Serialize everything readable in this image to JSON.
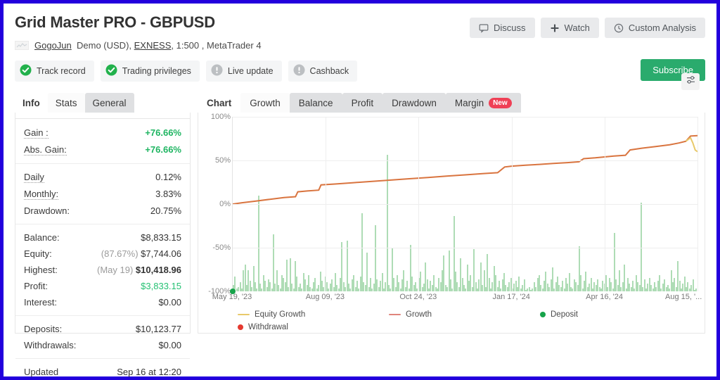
{
  "theme": {
    "page_border": "#2200dd",
    "accent_green": "#2aab6d",
    "value_green": "#1fb562",
    "badge_red": "#ef4056",
    "growth_line": "#d9743f",
    "equity_line": "#e8c96a",
    "bar_green": "#aedcb5"
  },
  "header": {
    "title": "Grid Master PRO - GBPUSD",
    "account_name": "GogoJun",
    "account_type": "Demo (USD),",
    "broker": "EXNESS",
    "leverage": ", 1:500 ,",
    "platform": "MetaTrader 4",
    "logo_icon": "broker-logo-icon",
    "buttons": [
      {
        "label": "Discuss",
        "icon": "speech-bubble-icon"
      },
      {
        "label": "Watch",
        "icon": "plus-icon"
      },
      {
        "label": "Custom Analysis",
        "icon": "clock-icon"
      }
    ]
  },
  "badges": [
    {
      "label": "Track record",
      "icon": "check-circle-icon",
      "state": "ok"
    },
    {
      "label": "Trading privileges",
      "icon": "check-circle-icon",
      "state": "ok"
    },
    {
      "label": "Live update",
      "icon": "exclamation-circle-icon",
      "state": "muted"
    },
    {
      "label": "Cashback",
      "icon": "exclamation-circle-icon",
      "state": "muted"
    }
  ],
  "subscribe_label": "Subscribe",
  "info_panel": {
    "tabs": [
      {
        "label": "Info",
        "state": "active"
      },
      {
        "label": "Stats",
        "state": "light"
      },
      {
        "label": "General",
        "state": "gray"
      }
    ],
    "groups": [
      [
        {
          "key": "Gain :",
          "value": "+76.66%",
          "style": "green",
          "key_style": "dot"
        },
        {
          "key": "Abs. Gain:",
          "value": "+76.66%",
          "style": "green",
          "key_style": "dot"
        }
      ],
      [
        {
          "key": "Daily",
          "value": "0.12%",
          "style": "plain",
          "key_style": "dot"
        },
        {
          "key": "Monthly:",
          "value": "3.83%",
          "style": "plain",
          "key_style": "dot"
        },
        {
          "key": "Drawdown:",
          "value": "20.75%",
          "style": "plain",
          "key_style": "none"
        }
      ],
      [
        {
          "key": "Balance:",
          "value": "$8,833.15",
          "style": "plain",
          "key_style": "none"
        },
        {
          "key": "Equity:",
          "value": "$7,744.06",
          "prefix": "(87.67%)",
          "style": "plain",
          "key_style": "none"
        },
        {
          "key": "Highest:",
          "value": "$10,418.96",
          "prefix": "(May 19)",
          "style": "bold",
          "key_style": "none"
        },
        {
          "key": "Profit:",
          "value": "$3,833.15",
          "style": "greenplain",
          "key_style": "none"
        },
        {
          "key": "Interest:",
          "value": "$0.00",
          "style": "plain",
          "key_style": "none"
        }
      ],
      [
        {
          "key": "Deposits:",
          "value": "$10,123.77",
          "style": "plain",
          "key_style": "none"
        },
        {
          "key": "Withdrawals:",
          "value": "$0.00",
          "style": "plain",
          "key_style": "none"
        }
      ],
      [
        {
          "key": "Updated",
          "value": "Sep 16 at 12:20",
          "style": "plain",
          "key_style": "none"
        }
      ]
    ]
  },
  "chart_panel": {
    "tabs": [
      {
        "label": "Chart",
        "state": "active",
        "badge": ""
      },
      {
        "label": "Growth",
        "state": "light",
        "badge": ""
      },
      {
        "label": "Balance",
        "state": "gray",
        "badge": ""
      },
      {
        "label": "Profit",
        "state": "gray",
        "badge": ""
      },
      {
        "label": "Drawdown",
        "state": "gray",
        "badge": ""
      },
      {
        "label": "Margin",
        "state": "gray",
        "badge": "New"
      }
    ],
    "settings_icon": "sliders-icon"
  },
  "chart_data": {
    "type": "line",
    "title": "",
    "xlabel": "",
    "ylabel": "",
    "ylim": [
      -100,
      100
    ],
    "ytick_labels": [
      "100%",
      "50%",
      "0%",
      "-50%",
      "-100%"
    ],
    "yticks": [
      100,
      50,
      0,
      -50,
      -100
    ],
    "grid": true,
    "legend_position": "bottom",
    "x_tick_labels": [
      "May 19, '23",
      "Aug 09, '23",
      "Oct 24, '23",
      "Jan 17, '24",
      "Apr 16, '24",
      "Aug 15, '..."
    ],
    "x_tick_positions": [
      0,
      0.2,
      0.4,
      0.6,
      0.8,
      1.0
    ],
    "legend": [
      {
        "name": "Equity Growth",
        "color": "#e8c96a",
        "marker": "line"
      },
      {
        "name": "Growth",
        "color": "#e0857c",
        "marker": "line"
      },
      {
        "name": "Deposit",
        "color": "#16a34a",
        "marker": "dot"
      },
      {
        "name": "Withdrawal",
        "color": "#e5392f",
        "marker": "dot"
      }
    ],
    "series": [
      {
        "name": "Growth",
        "color": "#d9743f",
        "x": [
          0,
          0.02,
          0.05,
          0.08,
          0.11,
          0.135,
          0.14,
          0.16,
          0.185,
          0.19,
          0.22,
          0.26,
          0.3,
          0.34,
          0.38,
          0.42,
          0.46,
          0.5,
          0.54,
          0.57,
          0.585,
          0.6,
          0.63,
          0.66,
          0.69,
          0.72,
          0.745,
          0.755,
          0.78,
          0.8,
          0.82,
          0.845,
          0.855,
          0.88,
          0.91,
          0.94,
          0.96,
          0.975,
          0.985,
          1.0
        ],
        "y": [
          0,
          1.5,
          3.5,
          5.5,
          7.5,
          8.5,
          14,
          15,
          16,
          22,
          23,
          24.5,
          26,
          27.5,
          29,
          30.5,
          32,
          33.5,
          35,
          36,
          42.5,
          43.5,
          44.5,
          45.5,
          46.5,
          47.5,
          48.5,
          52,
          53,
          54,
          55,
          56,
          62,
          64,
          66,
          68,
          70,
          72,
          78,
          78.5
        ]
      },
      {
        "name": "Equity Growth",
        "color": "#e8c96a",
        "x": [
          0.975,
          0.985,
          0.99,
          0.995,
          1.0
        ],
        "y": [
          72,
          76,
          70,
          62,
          60
        ]
      }
    ],
    "deposit_markers": [
      {
        "x": 0.0,
        "y": -100
      }
    ],
    "withdrawal_markers": [],
    "volume_bars": {
      "name": "Trade volume",
      "color": "#aedcb5",
      "values": [
        4,
        10,
        2,
        3,
        6,
        2,
        14,
        18,
        4,
        14,
        7,
        3,
        17,
        6,
        2,
        64,
        5,
        2,
        11,
        7,
        3,
        8,
        6,
        2,
        38,
        5,
        14,
        4,
        2,
        11,
        9,
        6,
        21,
        3,
        22,
        5,
        2,
        20,
        10,
        3,
        5,
        2,
        12,
        8,
        4,
        11,
        3,
        2,
        6,
        9,
        2,
        4,
        13,
        7,
        3,
        10,
        6,
        2,
        5,
        8,
        3,
        12,
        4,
        2,
        9,
        33,
        6,
        3,
        34,
        5,
        2,
        8,
        11,
        3,
        7,
        2,
        10,
        52,
        6,
        4,
        26,
        3,
        9,
        2,
        5,
        44,
        8,
        3,
        7,
        12,
        2,
        6,
        91,
        4,
        2,
        29,
        9,
        3,
        11,
        6,
        2,
        8,
        14,
        3,
        7,
        2,
        31,
        10,
        4,
        6,
        2,
        9,
        13,
        3,
        5,
        19,
        8,
        2,
        7,
        4,
        11,
        3,
        2,
        9,
        6,
        14,
        24,
        4,
        3,
        27,
        8,
        2,
        50,
        13,
        6,
        3,
        22,
        9,
        4,
        2,
        18,
        7,
        11,
        3,
        28,
        6,
        2,
        8,
        19,
        4,
        14,
        3,
        25,
        9,
        2,
        6,
        17,
        11,
        3,
        7,
        2,
        8,
        12,
        4,
        3,
        6,
        9,
        2,
        5,
        7,
        3,
        10,
        2,
        4,
        8,
        1,
        2,
        3,
        1,
        2,
        6,
        3,
        9,
        11,
        4,
        2,
        7,
        13,
        5,
        3,
        8,
        16,
        2,
        6,
        10,
        4,
        3,
        7,
        2,
        9,
        5,
        12,
        3,
        2,
        8,
        6,
        4,
        30,
        11,
        2,
        7,
        13,
        3,
        5,
        9,
        2,
        6,
        4,
        8,
        3,
        2,
        7,
        5,
        11,
        3,
        9,
        6,
        2,
        39,
        8,
        4,
        14,
        3,
        6,
        18,
        2,
        9,
        5,
        3,
        7,
        2,
        11,
        6,
        4,
        59,
        3,
        8,
        2,
        5,
        9,
        4,
        2,
        6,
        3,
        7,
        11,
        2,
        5,
        8,
        3,
        4,
        2,
        14,
        6,
        9,
        3,
        20,
        7,
        2,
        5,
        10,
        3,
        6,
        2,
        4,
        8,
        1,
        2
      ]
    }
  }
}
